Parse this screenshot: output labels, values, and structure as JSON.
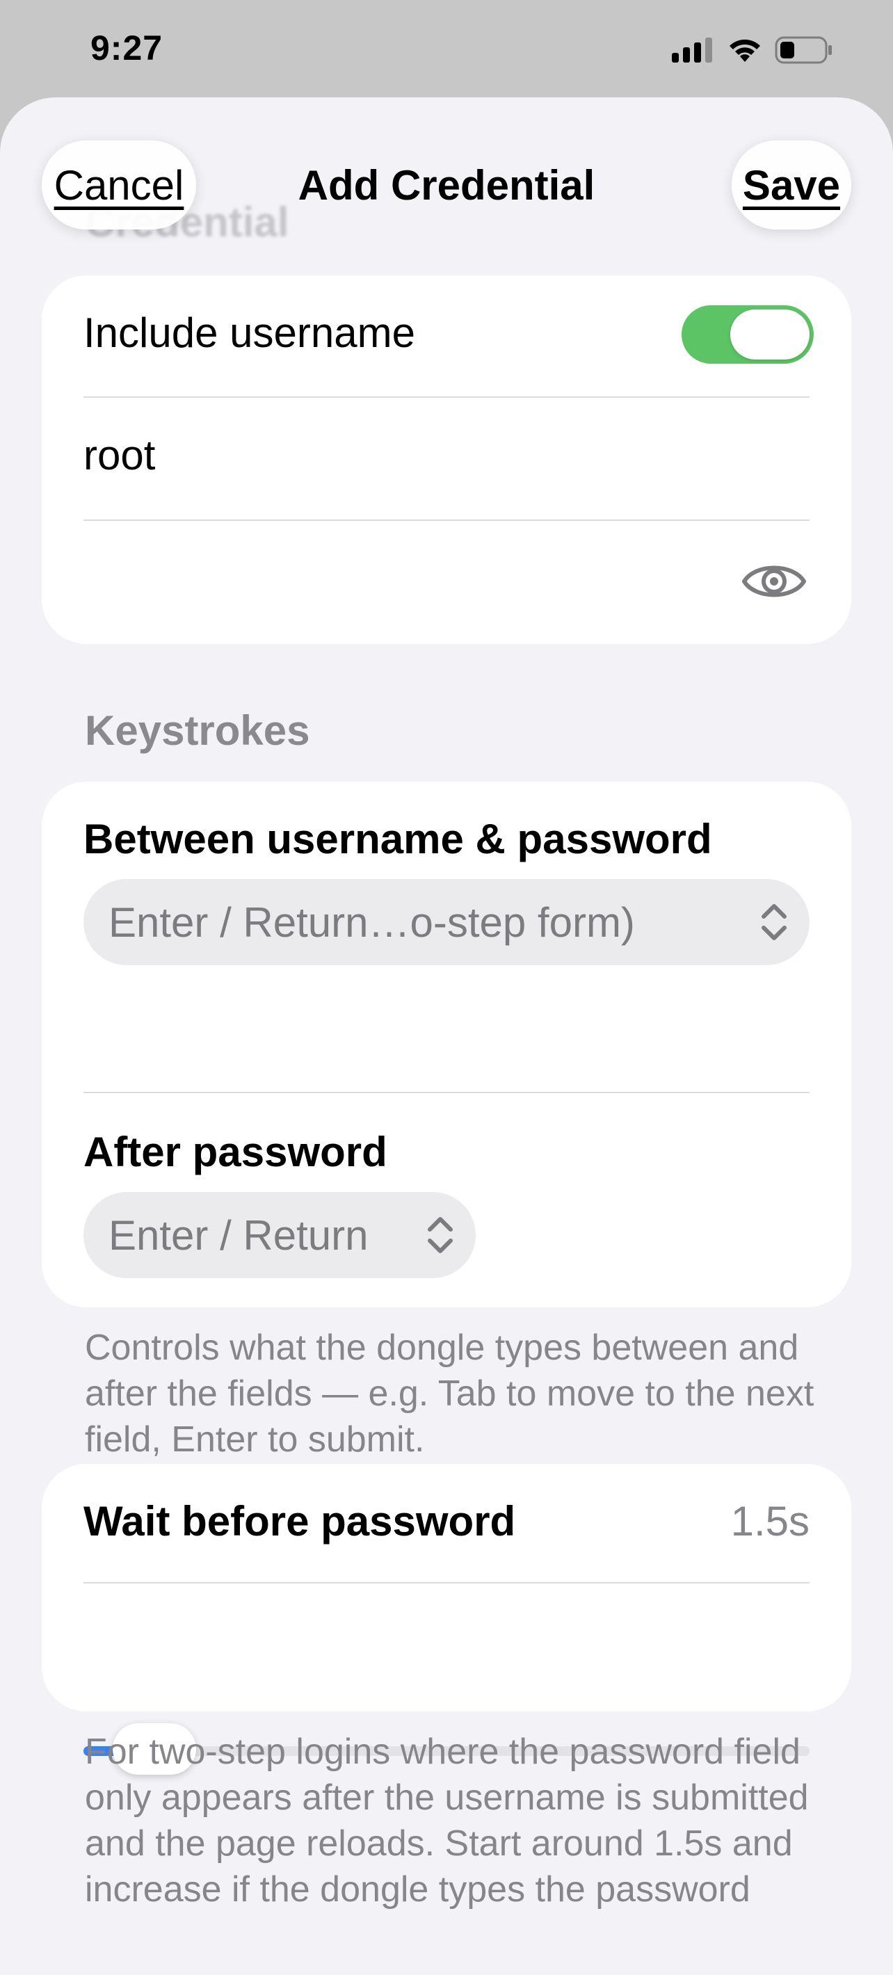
{
  "status_bar": {
    "time": "9:27",
    "icons": [
      "cellular-signal-icon",
      "wifi-icon",
      "battery-icon"
    ]
  },
  "nav": {
    "cancel_label": "Cancel",
    "title": "Add Credential",
    "save_label": "Save",
    "scrolled_section_header": "Credential"
  },
  "credential": {
    "include_username_label": "Include username",
    "include_username_on": true,
    "username_value": "root",
    "password_value": "",
    "reveal_icon": "eye-icon"
  },
  "keystrokes": {
    "header": "Keystrokes",
    "between_label": "Between username & password",
    "between_value": "Enter / Return…o-step form)",
    "after_label": "After password",
    "after_value": "Enter / Return",
    "footnote": "Controls what the dongle types between and after the fields — e.g. Tab to move to the next field, Enter to submit."
  },
  "wait": {
    "label": "Wait before password",
    "value_text": "1.5s",
    "slider_fraction": 0.05,
    "footnote": "For two-step logins where the password field only appears after the username is submitted and the page reloads. Start around 1.5s and increase if the dongle types the password"
  },
  "colors": {
    "accent": "#3b82f0",
    "toggle_on": "#5dc466",
    "background": "#f2f2f7"
  }
}
